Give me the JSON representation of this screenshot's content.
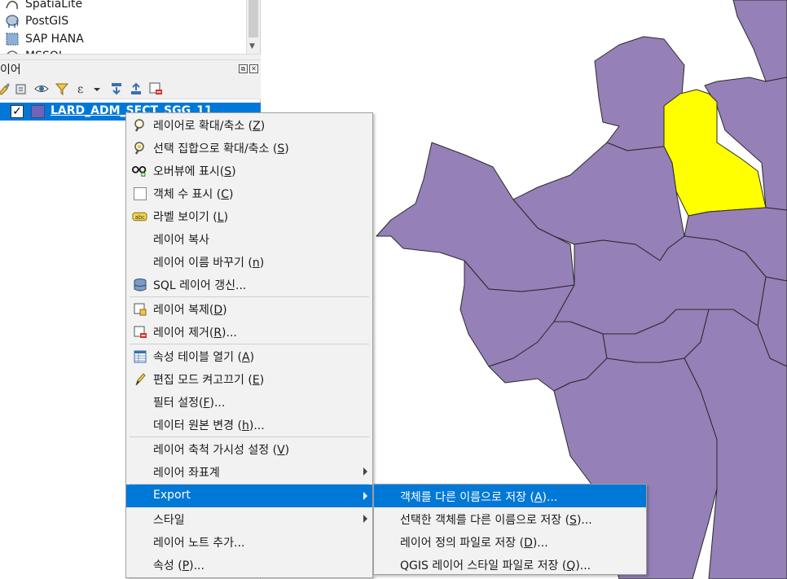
{
  "browser": {
    "items": [
      {
        "label": "SpatiaLite",
        "icon": "spatialite-icon"
      },
      {
        "label": "PostGIS",
        "icon": "postgis-elephant-icon"
      },
      {
        "label": "SAP HANA",
        "icon": "sap-hana-icon"
      },
      {
        "label": "MSSQL",
        "icon": "mssql-icon"
      }
    ]
  },
  "layers_panel": {
    "title": "이어",
    "header_buttons": [
      "float-button",
      "close-button"
    ],
    "toolbar_icons": [
      "style-brush-icon",
      "add-group-icon",
      "visibility-eye-icon",
      "filter-legend-icon",
      "filter-expression-icon",
      "dropdown-arrow-icon",
      "expand-all-icon",
      "collapse-all-icon",
      "remove-layer-icon"
    ]
  },
  "layer": {
    "name": "LARD_ADM_SECT_SGG_11",
    "checked": true,
    "swatch_color": "#6f64b5"
  },
  "context_menu": {
    "items": [
      {
        "label": "레이어로 확대/축소 (",
        "key": "Z",
        "suffix": ")",
        "icon": "zoom-to-layer-icon"
      },
      {
        "label": "선택 집합으로 확대/축소 (",
        "key": "S",
        "suffix": ")",
        "icon": "zoom-to-selection-icon"
      },
      {
        "label": "오버뷰에 표시(",
        "key": "S",
        "suffix": ")",
        "icon": "overview-glasses-icon"
      },
      {
        "label": "객체 수 표시 (",
        "key": "C",
        "suffix": ")",
        "icon": "checkbox-icon"
      },
      {
        "label": "라벨 보이기 (",
        "key": "L",
        "suffix": ")",
        "icon": "label-abc-icon"
      },
      {
        "label": "레이어 복사",
        "key": "",
        "suffix": "",
        "icon": ""
      },
      {
        "label": "레이어 이름 바꾸기 (",
        "key": "n",
        "suffix": ")",
        "icon": ""
      },
      {
        "label": "SQL 레이어 갱신...",
        "key": "",
        "suffix": "",
        "icon": "database-icon"
      },
      {
        "label": "레이어 복제(",
        "key": "D",
        "suffix": ")",
        "icon": "duplicate-layer-icon"
      },
      {
        "label": "레이어 제거(",
        "key": "R",
        "suffix": ")...",
        "icon": "remove-layer-icon"
      },
      {
        "label": "속성 테이블 열기 (",
        "key": "A",
        "suffix": ")",
        "icon": "attribute-table-icon"
      },
      {
        "label": "편집 모드 켜고끄기 (",
        "key": "E",
        "suffix": ")",
        "icon": "pencil-icon"
      },
      {
        "label": "필터 설정(",
        "key": "F",
        "suffix": ")...",
        "icon": ""
      },
      {
        "label": "데이터 원본 변경 (",
        "key": "h",
        "suffix": ")...",
        "icon": ""
      },
      {
        "label": "레이어 축척 가시성 설정 (",
        "key": "V",
        "suffix": ")",
        "icon": ""
      },
      {
        "label": "레이어 좌표계",
        "key": "",
        "suffix": "",
        "icon": "",
        "submenu": true
      },
      {
        "label": "Export",
        "key": "",
        "suffix": "",
        "icon": "",
        "submenu": true,
        "highlighted": true
      },
      {
        "label": "스타일",
        "key": "",
        "suffix": "",
        "icon": "",
        "submenu": true
      },
      {
        "label": "레이어 노트 추가...",
        "key": "",
        "suffix": "",
        "icon": ""
      },
      {
        "label": "속성 (",
        "key": "P",
        "suffix": ")...",
        "icon": ""
      }
    ]
  },
  "export_submenu": {
    "items": [
      {
        "label": "객체를 다른 이름으로 저장 (",
        "key": "A",
        "suffix": ")...",
        "highlighted": true
      },
      {
        "label": "선택한 객체를 다른 이름으로 저장 (",
        "key": "S",
        "suffix": ")..."
      },
      {
        "label": "레이어 정의 파일로 저장 (",
        "key": "D",
        "suffix": ")..."
      },
      {
        "label": "QGIS 레이어 스타일 파일로 저장 (",
        "key": "Q",
        "suffix": ")..."
      }
    ]
  },
  "map": {
    "fill_color": "#9580b8",
    "selected_fill_color": "#ffff00",
    "stroke_color": "#2a2a2a"
  }
}
